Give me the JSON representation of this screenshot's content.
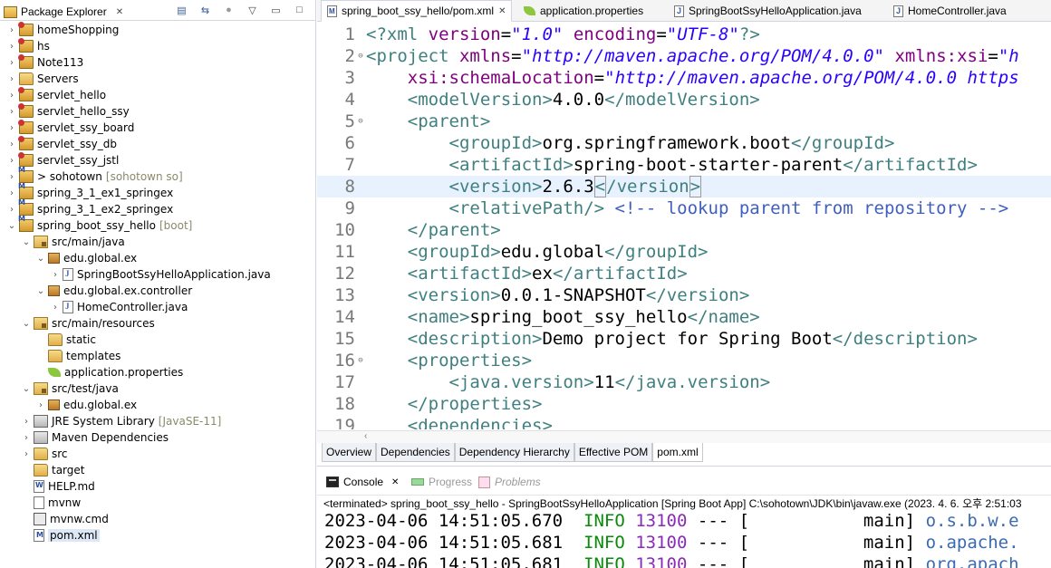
{
  "explorer": {
    "title": "Package Explorer",
    "close_glyph": "✕",
    "toolbar_icons": [
      "collapse-all-icon",
      "link-with-editor-icon",
      "focus-icon",
      "view-menu-icon",
      "minimize-icon",
      "maximize-icon"
    ],
    "items": [
      {
        "label": "homeShopping",
        "deco": "",
        "icon": "project"
      },
      {
        "label": "hs",
        "deco": "",
        "icon": "project"
      },
      {
        "label": "Note113",
        "deco": "",
        "icon": "project"
      },
      {
        "label": "Servers",
        "deco": "",
        "icon": "folder"
      },
      {
        "label": "servlet_hello",
        "deco": "",
        "icon": "project"
      },
      {
        "label": "servlet_hello_ssy",
        "deco": "",
        "icon": "project"
      },
      {
        "label": "servlet_ssy_board",
        "deco": "",
        "icon": "project"
      },
      {
        "label": "servlet_ssy_db",
        "deco": "",
        "icon": "project"
      },
      {
        "label": "servlet_ssy_jstl",
        "deco": "",
        "icon": "project"
      },
      {
        "label": "> sohotown",
        "deco": "[sohotown so]",
        "icon": "maven-project"
      },
      {
        "label": "spring_3_1_ex1_springex",
        "deco": "",
        "icon": "maven-project"
      },
      {
        "label": "spring_3_1_ex2_springex",
        "deco": "",
        "icon": "maven-project"
      },
      {
        "label": "spring_boot_ssy_hello",
        "deco": "[boot]",
        "icon": "maven-project"
      },
      {
        "label": "src/main/java",
        "deco": "",
        "icon": "source-folder"
      },
      {
        "label": "edu.global.ex",
        "deco": "",
        "icon": "package"
      },
      {
        "label": "SpringBootSsyHelloApplication.java",
        "deco": "",
        "icon": "java-file"
      },
      {
        "label": "edu.global.ex.controller",
        "deco": "",
        "icon": "package"
      },
      {
        "label": "HomeController.java",
        "deco": "",
        "icon": "java-file"
      },
      {
        "label": "src/main/resources",
        "deco": "",
        "icon": "source-folder"
      },
      {
        "label": "static",
        "deco": "",
        "icon": "folder"
      },
      {
        "label": "templates",
        "deco": "",
        "icon": "folder"
      },
      {
        "label": "application.properties",
        "deco": "",
        "icon": "properties-file"
      },
      {
        "label": "src/test/java",
        "deco": "",
        "icon": "source-folder"
      },
      {
        "label": "edu.global.ex",
        "deco": "",
        "icon": "package"
      },
      {
        "label": "JRE System Library",
        "deco": "[JavaSE-11]",
        "icon": "library"
      },
      {
        "label": "Maven Dependencies",
        "deco": "",
        "icon": "library"
      },
      {
        "label": "src",
        "deco": "",
        "icon": "folder"
      },
      {
        "label": "target",
        "deco": "",
        "icon": "folder"
      },
      {
        "label": "HELP.md",
        "deco": "",
        "icon": "md-file"
      },
      {
        "label": "mvnw",
        "deco": "",
        "icon": "file"
      },
      {
        "label": "mvnw.cmd",
        "deco": "",
        "icon": "cmd-file"
      },
      {
        "label": "pom.xml",
        "deco": "",
        "icon": "xml-file"
      }
    ]
  },
  "editor": {
    "tabs": [
      {
        "label": "spring_boot_ssy_hello/pom.xml",
        "active": true
      },
      {
        "label": "application.properties",
        "active": false
      },
      {
        "label": "SpringBootSsyHelloApplication.java",
        "active": false
      },
      {
        "label": "HomeController.java",
        "active": false
      }
    ],
    "line_numbers": [
      "1",
      "2",
      "3",
      "4",
      "5",
      "6",
      "7",
      "8",
      "9",
      "10",
      "11",
      "12",
      "13",
      "14",
      "15",
      "16",
      "17",
      "18",
      "19"
    ],
    "current_line": "8",
    "lines": {
      "l1": {
        "a": "<?xml ",
        "b": "version",
        "c": "=",
        "d": "\"1.0\"",
        "e": " ",
        "f": "encoding",
        "g": "=",
        "h": "\"UTF-8\"",
        "i": "?>"
      },
      "l2": {
        "a": "<project ",
        "b": "xmlns",
        "c": "=",
        "d": "\"http://maven.apache.org/POM/4.0.0\"",
        "e": " ",
        "f": "xmlns:xsi",
        "g": "=",
        "h": "\"h"
      },
      "l3": {
        "indent": "    ",
        "b": "xsi:schemaLocation",
        "c": "=",
        "d": "\"http://maven.apache.org/POM/4.0.0 https"
      },
      "l4": {
        "indent": "    ",
        "open": "<modelVersion>",
        "text": "4.0.0",
        "close": "</modelVersion>"
      },
      "l5": {
        "indent": "    ",
        "open": "<parent>"
      },
      "l6": {
        "indent": "        ",
        "open": "<groupId>",
        "text": "org.springframework.boot",
        "close": "</groupId>"
      },
      "l7": {
        "indent": "        ",
        "open": "<artifactId>",
        "text": "spring-boot-starter-parent",
        "close": "</artifactId>"
      },
      "l8": {
        "indent": "        ",
        "open": "<version>",
        "text": "2.6.3",
        "close_a": "<",
        "close_b": "/version",
        "close_c": ">"
      },
      "l9": {
        "indent": "        ",
        "open": "<relativePath/>",
        "comment": " <!-- lookup parent from repository -->"
      },
      "l10": {
        "indent": "    ",
        "close": "</parent>"
      },
      "l11": {
        "indent": "    ",
        "open": "<groupId>",
        "text": "edu.global",
        "close": "</groupId>"
      },
      "l12": {
        "indent": "    ",
        "open": "<artifactId>",
        "text": "ex",
        "close": "</artifactId>"
      },
      "l13": {
        "indent": "    ",
        "open": "<version>",
        "text": "0.0.1-SNAPSHOT",
        "close": "</version>"
      },
      "l14": {
        "indent": "    ",
        "open": "<name>",
        "text": "spring_boot_ssy_hello",
        "close": "</name>"
      },
      "l15": {
        "indent": "    ",
        "open": "<description>",
        "text": "Demo project for Spring Boot",
        "close": "</description>"
      },
      "l16": {
        "indent": "    ",
        "open": "<properties>"
      },
      "l17": {
        "indent": "        ",
        "open": "<java.version>",
        "text": "11",
        "close": "</java.version>"
      },
      "l18": {
        "indent": "    ",
        "close": "</properties>"
      },
      "l19": {
        "indent": "    ",
        "open": "<dependencies>"
      }
    },
    "bottom_tabs": [
      "Overview",
      "Dependencies",
      "Dependency Hierarchy",
      "Effective POM",
      "pom.xml"
    ],
    "active_bottom_tab": "pom.xml"
  },
  "console": {
    "tabs": [
      "Console",
      "Progress",
      "Problems"
    ],
    "status": "<terminated> spring_boot_ssy_hello - SpringBootSsyHelloApplication [Spring Boot App] C:\\sohotown\\JDK\\bin\\javaw.exe (2023. 4. 6. 오후 2:51:03",
    "log": [
      {
        "ts": "2023-04-06 14:51:05.670",
        "level": "INFO",
        "pid": "13100",
        "sep": "---",
        "thread": "[           main]",
        "logger": "o.s.b.w.e"
      },
      {
        "ts": "2023-04-06 14:51:05.681",
        "level": "INFO",
        "pid": "13100",
        "sep": "---",
        "thread": "[           main]",
        "logger": "o.apache."
      },
      {
        "ts": "2023-04-06 14:51:05.681",
        "level": "INFO",
        "pid": "13100",
        "sep": "---",
        "thread": "[           main]",
        "logger": "org.apach"
      }
    ]
  }
}
